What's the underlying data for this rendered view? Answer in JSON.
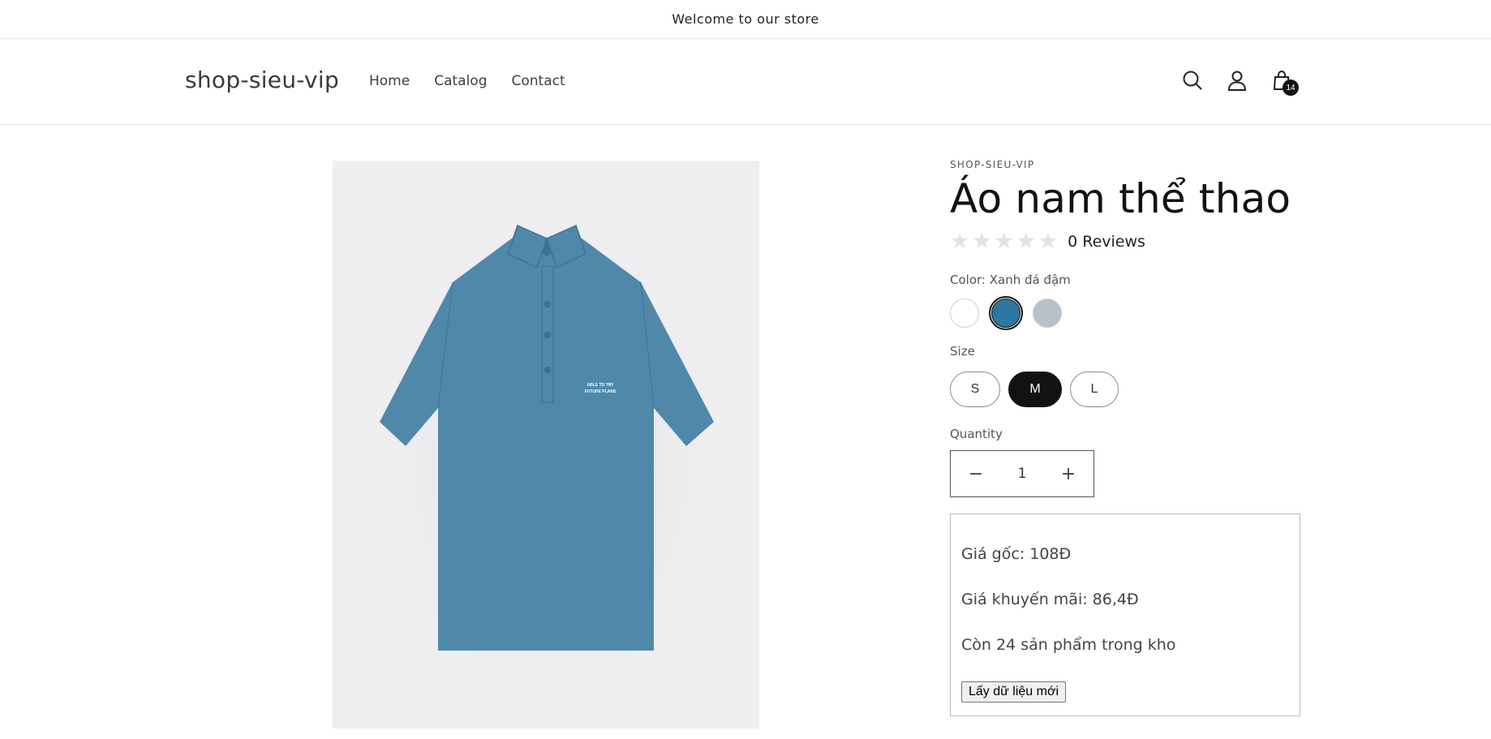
{
  "announcement": "Welcome to our store",
  "header": {
    "logo": "shop-sieu-vip",
    "nav": [
      "Home",
      "Catalog",
      "Contact"
    ],
    "icons": [
      "search-icon",
      "account-icon",
      "cart-icon"
    ],
    "cart_count": "14"
  },
  "product": {
    "vendor": "SHOP-SIEU-VIP",
    "title": "Áo nam thể thao",
    "rating": {
      "stars": 0,
      "max": 5,
      "reviews_text": "0 Reviews"
    },
    "color": {
      "label": "Color: Xanh đá đậm",
      "swatches": [
        {
          "name": "white",
          "hex": "#ffffff",
          "selected": false
        },
        {
          "name": "Xanh đá đậm",
          "hex": "#2f76a4",
          "selected": true
        },
        {
          "name": "grey",
          "hex": "#b8c0c8",
          "selected": false
        }
      ]
    },
    "size": {
      "label": "Size",
      "options": [
        "S",
        "M",
        "L"
      ],
      "selected": "M"
    },
    "quantity": {
      "label": "Quantity",
      "value": "1",
      "decrease": "−",
      "increase": "+"
    },
    "stock_box": {
      "original_price": "Giá gốc: 108Đ",
      "sale_price": "Giá khuyến mãi: 86,4Đ",
      "stock": "Còn 24 sản phẩm trong kho",
      "refresh_button": "Lấy dữ liệu mới"
    },
    "image": {
      "shirt_color": "#5088aa",
      "print_text_line1": "ABLE TO TRY",
      "print_text_line2": "FUTURE PLANS"
    }
  }
}
